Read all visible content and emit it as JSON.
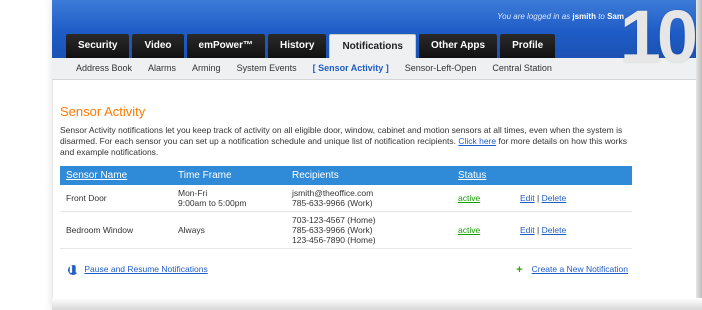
{
  "login": {
    "prefix": "You are logged in as ",
    "user": "jsmith",
    "suffix": " to ",
    "site": "Sam"
  },
  "overlay_number": "10",
  "tabs": [
    {
      "label": "Security"
    },
    {
      "label": "Video"
    },
    {
      "label": "emPower™"
    },
    {
      "label": "History"
    },
    {
      "label": "Notifications"
    },
    {
      "label": "Other Apps"
    },
    {
      "label": "Profile"
    }
  ],
  "subnav": [
    {
      "label": "Address Book"
    },
    {
      "label": "Alarms"
    },
    {
      "label": "Arming"
    },
    {
      "label": "System Events"
    },
    {
      "label": "[ Sensor Activity ]"
    },
    {
      "label": "Sensor-Left-Open"
    },
    {
      "label": "Central Station"
    }
  ],
  "page": {
    "title": "Sensor Activity",
    "desc_pre": "Sensor Activity notifications let you keep track of activity on all eligible door, window, cabinet and motion sensors at all times, even when the system is disarmed. For each sensor you can set up a notification schedule and unique list of notification recipients. ",
    "desc_link": "Click here",
    "desc_post": " for more details on how this works and example notifications."
  },
  "table": {
    "headers": {
      "sensor": "Sensor Name",
      "time": "Time Frame",
      "recipients": "Recipients",
      "status": "Status"
    },
    "rows": [
      {
        "sensor": "Front Door",
        "time_line1": "Mon-Fri",
        "time_line2": "9:00am to 5:00pm",
        "rec_line1": "jsmith@theoffice.com",
        "rec_line2": "785-633-9966 (Work)",
        "rec_line3": "",
        "status": "active",
        "edit": "Edit",
        "sep": "|",
        "delete": "Delete"
      },
      {
        "sensor": "Bedroom Window",
        "time_line1": "Always",
        "time_line2": "",
        "rec_line1": "703-123-4567 (Home)",
        "rec_line2": "785-633-9966 (Work)",
        "rec_line3": "123-456-7890 (Home)",
        "status": "active",
        "edit": "Edit",
        "sep": "|",
        "delete": "Delete"
      }
    ]
  },
  "footer": {
    "pause": "Pause and Resume Notifications",
    "create": "Create a New Notification"
  },
  "colors": {
    "topbar_blue": "#1f5cc6",
    "title_orange": "#ff7a00",
    "header_blue": "#2f8ad8",
    "status_green": "#18a000"
  }
}
